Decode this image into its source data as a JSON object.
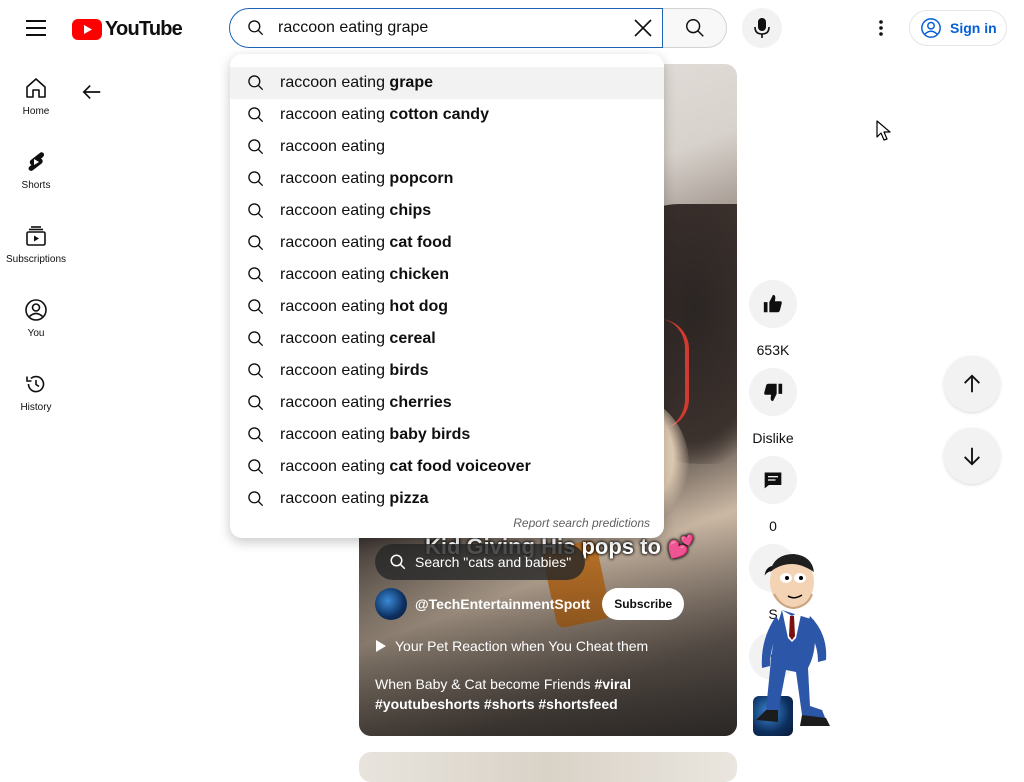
{
  "header": {
    "logo_text": "YouTube",
    "search_value": "raccoon eating grape",
    "sign_in_label": "Sign in"
  },
  "sidebar": {
    "items": [
      {
        "label": "Home",
        "icon": "home-icon"
      },
      {
        "label": "Shorts",
        "icon": "shorts-icon"
      },
      {
        "label": "Subscriptions",
        "icon": "subscriptions-icon"
      },
      {
        "label": "You",
        "icon": "you-icon"
      },
      {
        "label": "History",
        "icon": "history-icon"
      }
    ]
  },
  "suggestions": {
    "prefix": "raccoon eating",
    "items": [
      {
        "rest": "grape"
      },
      {
        "rest": "cotton candy"
      },
      {
        "rest": ""
      },
      {
        "rest": "popcorn"
      },
      {
        "rest": "chips"
      },
      {
        "rest": "cat food"
      },
      {
        "rest": "chicken"
      },
      {
        "rest": "hot dog"
      },
      {
        "rest": "cereal"
      },
      {
        "rest": "birds"
      },
      {
        "rest": "cherries"
      },
      {
        "rest": "baby birds"
      },
      {
        "rest": "cat food voiceover"
      },
      {
        "rest": "pizza"
      }
    ],
    "report_label": "Report search predictions"
  },
  "video": {
    "overlay_caption": "Kid Giving His pops to",
    "overlay_emoji": "💕",
    "in_video_search": "Search \"cats and babies\"",
    "channel_name": "@TechEntertainmentSpott",
    "subscribe_label": "Subscribe",
    "playlist_title": "Your Pet Reaction when You Cheat them",
    "description_text": "When Baby & Cat become Friends",
    "hashtags": [
      "#viral",
      "#youtubeshorts",
      "#shorts",
      "#shortsfeed"
    ]
  },
  "actions": {
    "like_count": "653K",
    "dislike_label": "Dislike",
    "comment_count": "0",
    "share_label": "S"
  },
  "colors": {
    "brand_red": "#ff0000",
    "link_blue": "#065fd4",
    "search_border": "#1c62b9"
  }
}
